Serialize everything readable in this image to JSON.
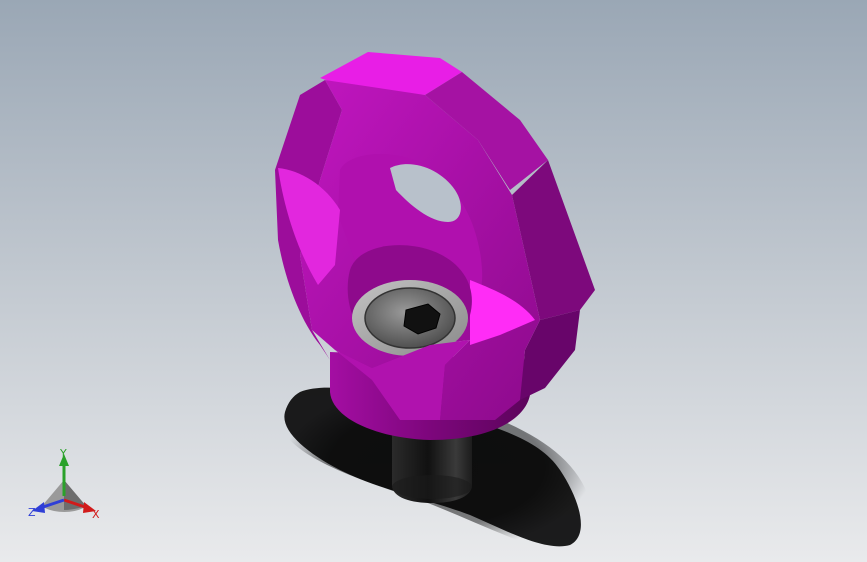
{
  "viewport": {
    "background_top": "#9aa7b5",
    "background_bottom": "#e9eaec",
    "model": {
      "part": "swivel-lifting-eye-bolt",
      "body_color": "#b70fb5",
      "highlight_color": "#e41ee0",
      "shadow_color": "#6b0469",
      "shaft_color": "#1a1a1a",
      "socket_screw_color": "#5a5a5a"
    }
  },
  "triad": {
    "x_label": "X",
    "y_label": "Y",
    "z_label": "Z",
    "x_color": "#d11b1b",
    "y_color": "#2aa12a",
    "z_color": "#2f3fd6"
  }
}
